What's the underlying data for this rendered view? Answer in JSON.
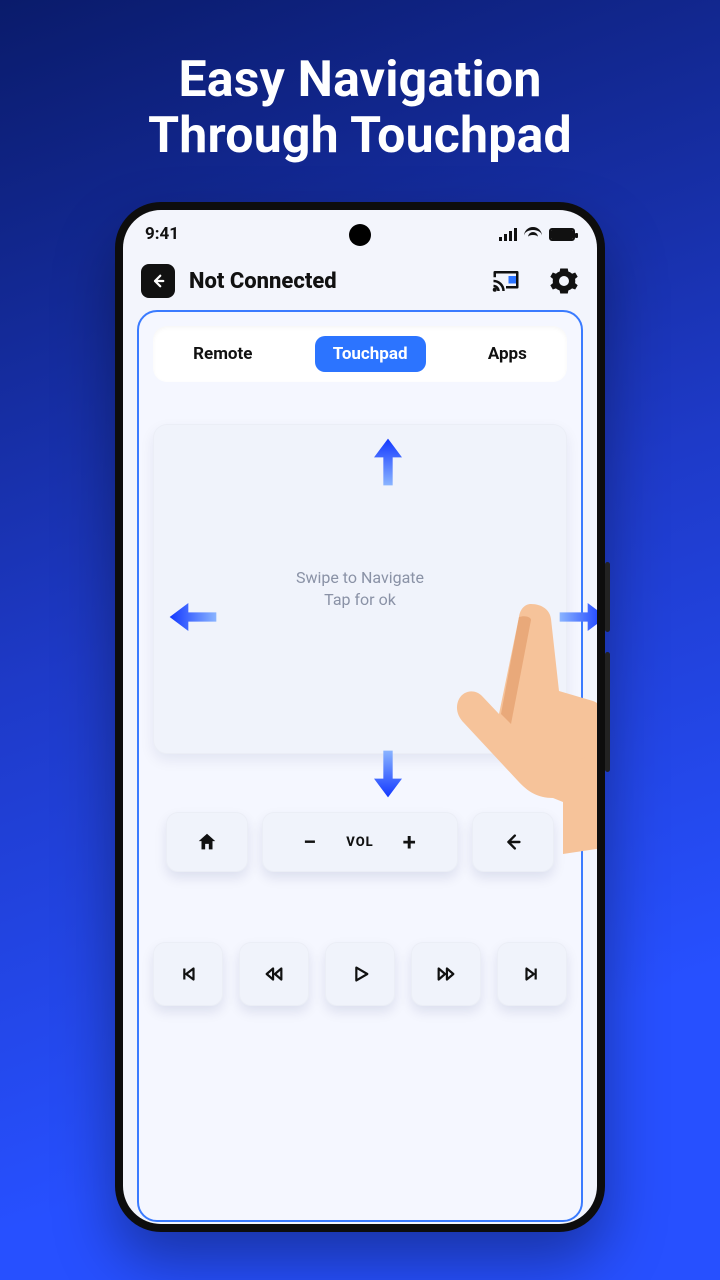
{
  "promo": {
    "line1": "Easy Navigation",
    "line2": "Through Touchpad"
  },
  "statusbar": {
    "time": "9:41"
  },
  "header": {
    "title": "Not Connected",
    "back_icon": "arrow-left",
    "cast_icon": "cast",
    "settings_icon": "gear"
  },
  "tabs": {
    "remote": "Remote",
    "touchpad": "Touchpad",
    "apps": "Apps",
    "active": "touchpad"
  },
  "touchpad": {
    "hint_line1": "Swipe to Navigate",
    "hint_line2": "Tap for ok"
  },
  "controls": {
    "vol_label": "VOL",
    "vol_minus": "−",
    "vol_plus": "+"
  },
  "media_icons": [
    "skip-prev",
    "rewind",
    "play",
    "forward",
    "skip-next"
  ]
}
